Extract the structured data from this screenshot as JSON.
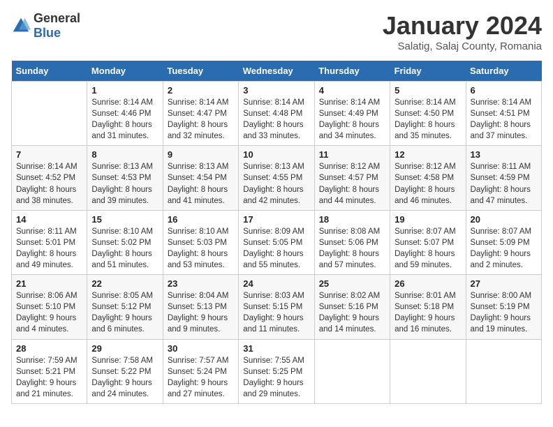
{
  "logo": {
    "general": "General",
    "blue": "Blue"
  },
  "title": "January 2024",
  "subtitle": "Salatig, Salaj County, Romania",
  "days_of_week": [
    "Sunday",
    "Monday",
    "Tuesday",
    "Wednesday",
    "Thursday",
    "Friday",
    "Saturday"
  ],
  "weeks": [
    [
      {
        "day": "",
        "info": ""
      },
      {
        "day": "1",
        "info": "Sunrise: 8:14 AM\nSunset: 4:46 PM\nDaylight: 8 hours\nand 31 minutes."
      },
      {
        "day": "2",
        "info": "Sunrise: 8:14 AM\nSunset: 4:47 PM\nDaylight: 8 hours\nand 32 minutes."
      },
      {
        "day": "3",
        "info": "Sunrise: 8:14 AM\nSunset: 4:48 PM\nDaylight: 8 hours\nand 33 minutes."
      },
      {
        "day": "4",
        "info": "Sunrise: 8:14 AM\nSunset: 4:49 PM\nDaylight: 8 hours\nand 34 minutes."
      },
      {
        "day": "5",
        "info": "Sunrise: 8:14 AM\nSunset: 4:50 PM\nDaylight: 8 hours\nand 35 minutes."
      },
      {
        "day": "6",
        "info": "Sunrise: 8:14 AM\nSunset: 4:51 PM\nDaylight: 8 hours\nand 37 minutes."
      }
    ],
    [
      {
        "day": "7",
        "info": ""
      },
      {
        "day": "8",
        "info": "Sunrise: 8:13 AM\nSunset: 4:53 PM\nDaylight: 8 hours\nand 39 minutes."
      },
      {
        "day": "9",
        "info": "Sunrise: 8:13 AM\nSunset: 4:54 PM\nDaylight: 8 hours\nand 41 minutes."
      },
      {
        "day": "10",
        "info": "Sunrise: 8:13 AM\nSunset: 4:55 PM\nDaylight: 8 hours\nand 42 minutes."
      },
      {
        "day": "11",
        "info": "Sunrise: 8:12 AM\nSunset: 4:57 PM\nDaylight: 8 hours\nand 44 minutes."
      },
      {
        "day": "12",
        "info": "Sunrise: 8:12 AM\nSunset: 4:58 PM\nDaylight: 8 hours\nand 46 minutes."
      },
      {
        "day": "13",
        "info": "Sunrise: 8:11 AM\nSunset: 4:59 PM\nDaylight: 8 hours\nand 47 minutes."
      }
    ],
    [
      {
        "day": "14",
        "info": ""
      },
      {
        "day": "15",
        "info": "Sunrise: 8:10 AM\nSunset: 5:02 PM\nDaylight: 8 hours\nand 51 minutes."
      },
      {
        "day": "16",
        "info": "Sunrise: 8:10 AM\nSunset: 5:03 PM\nDaylight: 8 hours\nand 53 minutes."
      },
      {
        "day": "17",
        "info": "Sunrise: 8:09 AM\nSunset: 5:05 PM\nDaylight: 8 hours\nand 55 minutes."
      },
      {
        "day": "18",
        "info": "Sunrise: 8:08 AM\nSunset: 5:06 PM\nDaylight: 8 hours\nand 57 minutes."
      },
      {
        "day": "19",
        "info": "Sunrise: 8:07 AM\nSunset: 5:07 PM\nDaylight: 8 hours\nand 59 minutes."
      },
      {
        "day": "20",
        "info": "Sunrise: 8:07 AM\nSunset: 5:09 PM\nDaylight: 9 hours\nand 2 minutes."
      }
    ],
    [
      {
        "day": "21",
        "info": ""
      },
      {
        "day": "22",
        "info": "Sunrise: 8:05 AM\nSunset: 5:12 PM\nDaylight: 9 hours\nand 6 minutes."
      },
      {
        "day": "23",
        "info": "Sunrise: 8:04 AM\nSunset: 5:13 PM\nDaylight: 9 hours\nand 9 minutes."
      },
      {
        "day": "24",
        "info": "Sunrise: 8:03 AM\nSunset: 5:15 PM\nDaylight: 9 hours\nand 11 minutes."
      },
      {
        "day": "25",
        "info": "Sunrise: 8:02 AM\nSunset: 5:16 PM\nDaylight: 9 hours\nand 14 minutes."
      },
      {
        "day": "26",
        "info": "Sunrise: 8:01 AM\nSunset: 5:18 PM\nDaylight: 9 hours\nand 16 minutes."
      },
      {
        "day": "27",
        "info": "Sunrise: 8:00 AM\nSunset: 5:19 PM\nDaylight: 9 hours\nand 19 minutes."
      }
    ],
    [
      {
        "day": "28",
        "info": "Sunrise: 7:59 AM\nSunset: 5:21 PM\nDaylight: 9 hours\nand 21 minutes."
      },
      {
        "day": "29",
        "info": "Sunrise: 7:58 AM\nSunset: 5:22 PM\nDaylight: 9 hours\nand 24 minutes."
      },
      {
        "day": "30",
        "info": "Sunrise: 7:57 AM\nSunset: 5:24 PM\nDaylight: 9 hours\nand 27 minutes."
      },
      {
        "day": "31",
        "info": "Sunrise: 7:55 AM\nSunset: 5:25 PM\nDaylight: 9 hours\nand 29 minutes."
      },
      {
        "day": "",
        "info": ""
      },
      {
        "day": "",
        "info": ""
      },
      {
        "day": "",
        "info": ""
      }
    ]
  ],
  "week2_sun": {
    "day": "7",
    "info": "Sunrise: 8:14 AM\nSunset: 4:52 PM\nDaylight: 8 hours\nand 38 minutes."
  },
  "week3_sun": {
    "day": "14",
    "info": "Sunrise: 8:11 AM\nSunset: 5:01 PM\nDaylight: 8 hours\nand 49 minutes."
  },
  "week4_sun": {
    "day": "21",
    "info": "Sunrise: 8:06 AM\nSunset: 5:10 PM\nDaylight: 9 hours\nand 4 minutes."
  }
}
